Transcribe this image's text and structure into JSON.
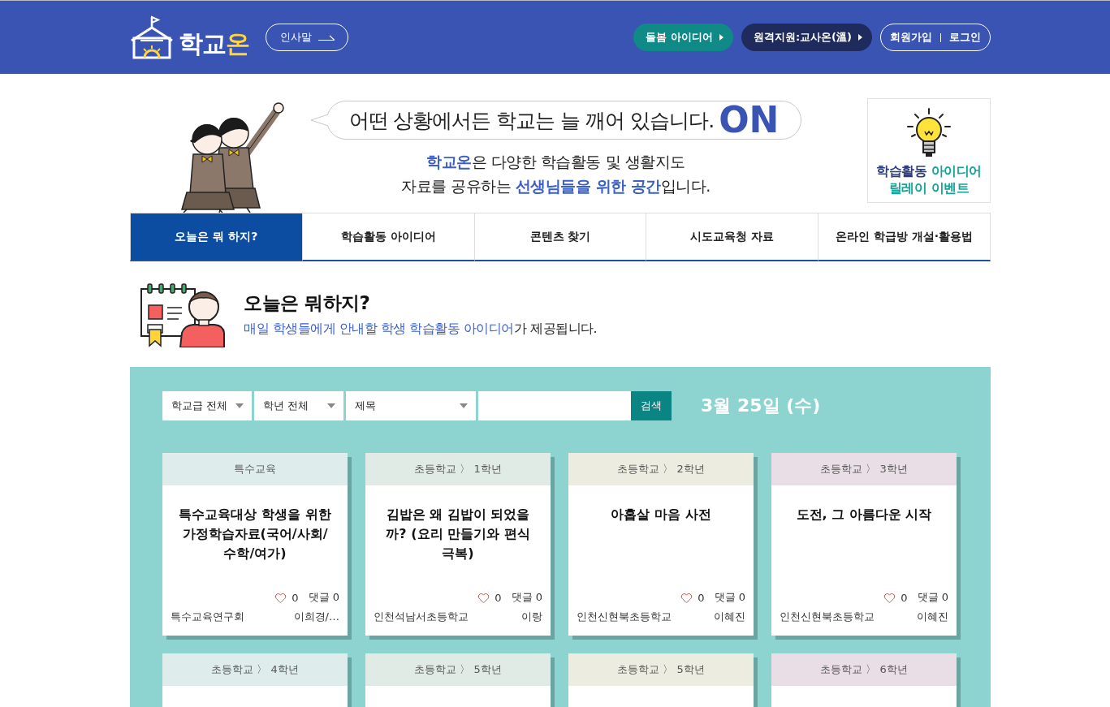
{
  "header": {
    "logo": {
      "text": "학교",
      "accent": "온"
    },
    "greeting_button": "인사말",
    "nav_buttons": [
      {
        "label": "돌봄 아이디어",
        "kind": "teal"
      },
      {
        "label": "원격지원:교사온(溫)",
        "kind": "navy"
      }
    ],
    "auth_links": [
      "회원가입",
      "로그인"
    ]
  },
  "banner": {
    "slogan": "어떤 상황에서든 학교는 늘 깨어 있습니다.",
    "slogan_mark": "ON",
    "description": [
      "**학교온**은 다양한 학습활동 및 생활지도",
      "자료를 공유하는 **선생님들을 위한 공간**입니다."
    ],
    "event": {
      "lead": "학습활동",
      "accent": "아이디어",
      "line_2": "릴레이 이벤트"
    }
  },
  "tabs": [
    {
      "label": "오늘은 뭐 하지?",
      "selected": true
    },
    {
      "label": "학습활동 아이디어",
      "selected": false
    },
    {
      "label": "콘텐츠 찾기",
      "selected": false
    },
    {
      "label": "시도교육청 자료",
      "selected": false
    },
    {
      "label": "온라인 학급방 개설·활용법",
      "selected": false
    }
  ],
  "intro": {
    "title": "오늘은 뭐하지?",
    "highlight": "매일 학생들에게 안내할 학생 학습활동 아이디어",
    "rest": "가 제공됩니다."
  },
  "filters": {
    "selects": [
      "학교급 전체",
      "학년 전체",
      "제목"
    ],
    "search_button": "검색",
    "date": "3월 25일 (수)"
  },
  "cards": [
    {
      "category": "특수교육",
      "color": "#dfecec",
      "title": "특수교육대상 학생을 위한 가정학습자료(국어/사회/수학/여가)",
      "likes": "0",
      "comments": "댓글 0",
      "school": "특수교육연구회",
      "author": "이희경/…"
    },
    {
      "category": "초등학교 〉 1학년",
      "color": "#dfebe4",
      "title": "김밥은 왜 김밥이 되었을까? (요리 만들기와 편식 극복)",
      "likes": "0",
      "comments": "댓글 0",
      "school": "인천석남서초등학교",
      "author": "이랑"
    },
    {
      "category": "초등학교 〉 2학년",
      "color": "#ecede0",
      "title": "아홉살 마음 사전",
      "likes": "0",
      "comments": "댓글 0",
      "school": "인천신현북초등학교",
      "author": "이혜진"
    },
    {
      "category": "초등학교 〉 3학년",
      "color": "#eadee6",
      "title": "도전, 그 아름다운 시작",
      "likes": "0",
      "comments": "댓글 0",
      "school": "인천신현북초등학교",
      "author": "이혜진"
    },
    {
      "category": "초등학교 〉 4학년",
      "color": "#dfecec"
    },
    {
      "category": "초등학교 〉 5학년",
      "color": "#dfebe4"
    },
    {
      "category": "초등학교 〉 5학년",
      "color": "#ecede0"
    },
    {
      "category": "초등학교 〉 6학년",
      "color": "#eadee6"
    }
  ]
}
